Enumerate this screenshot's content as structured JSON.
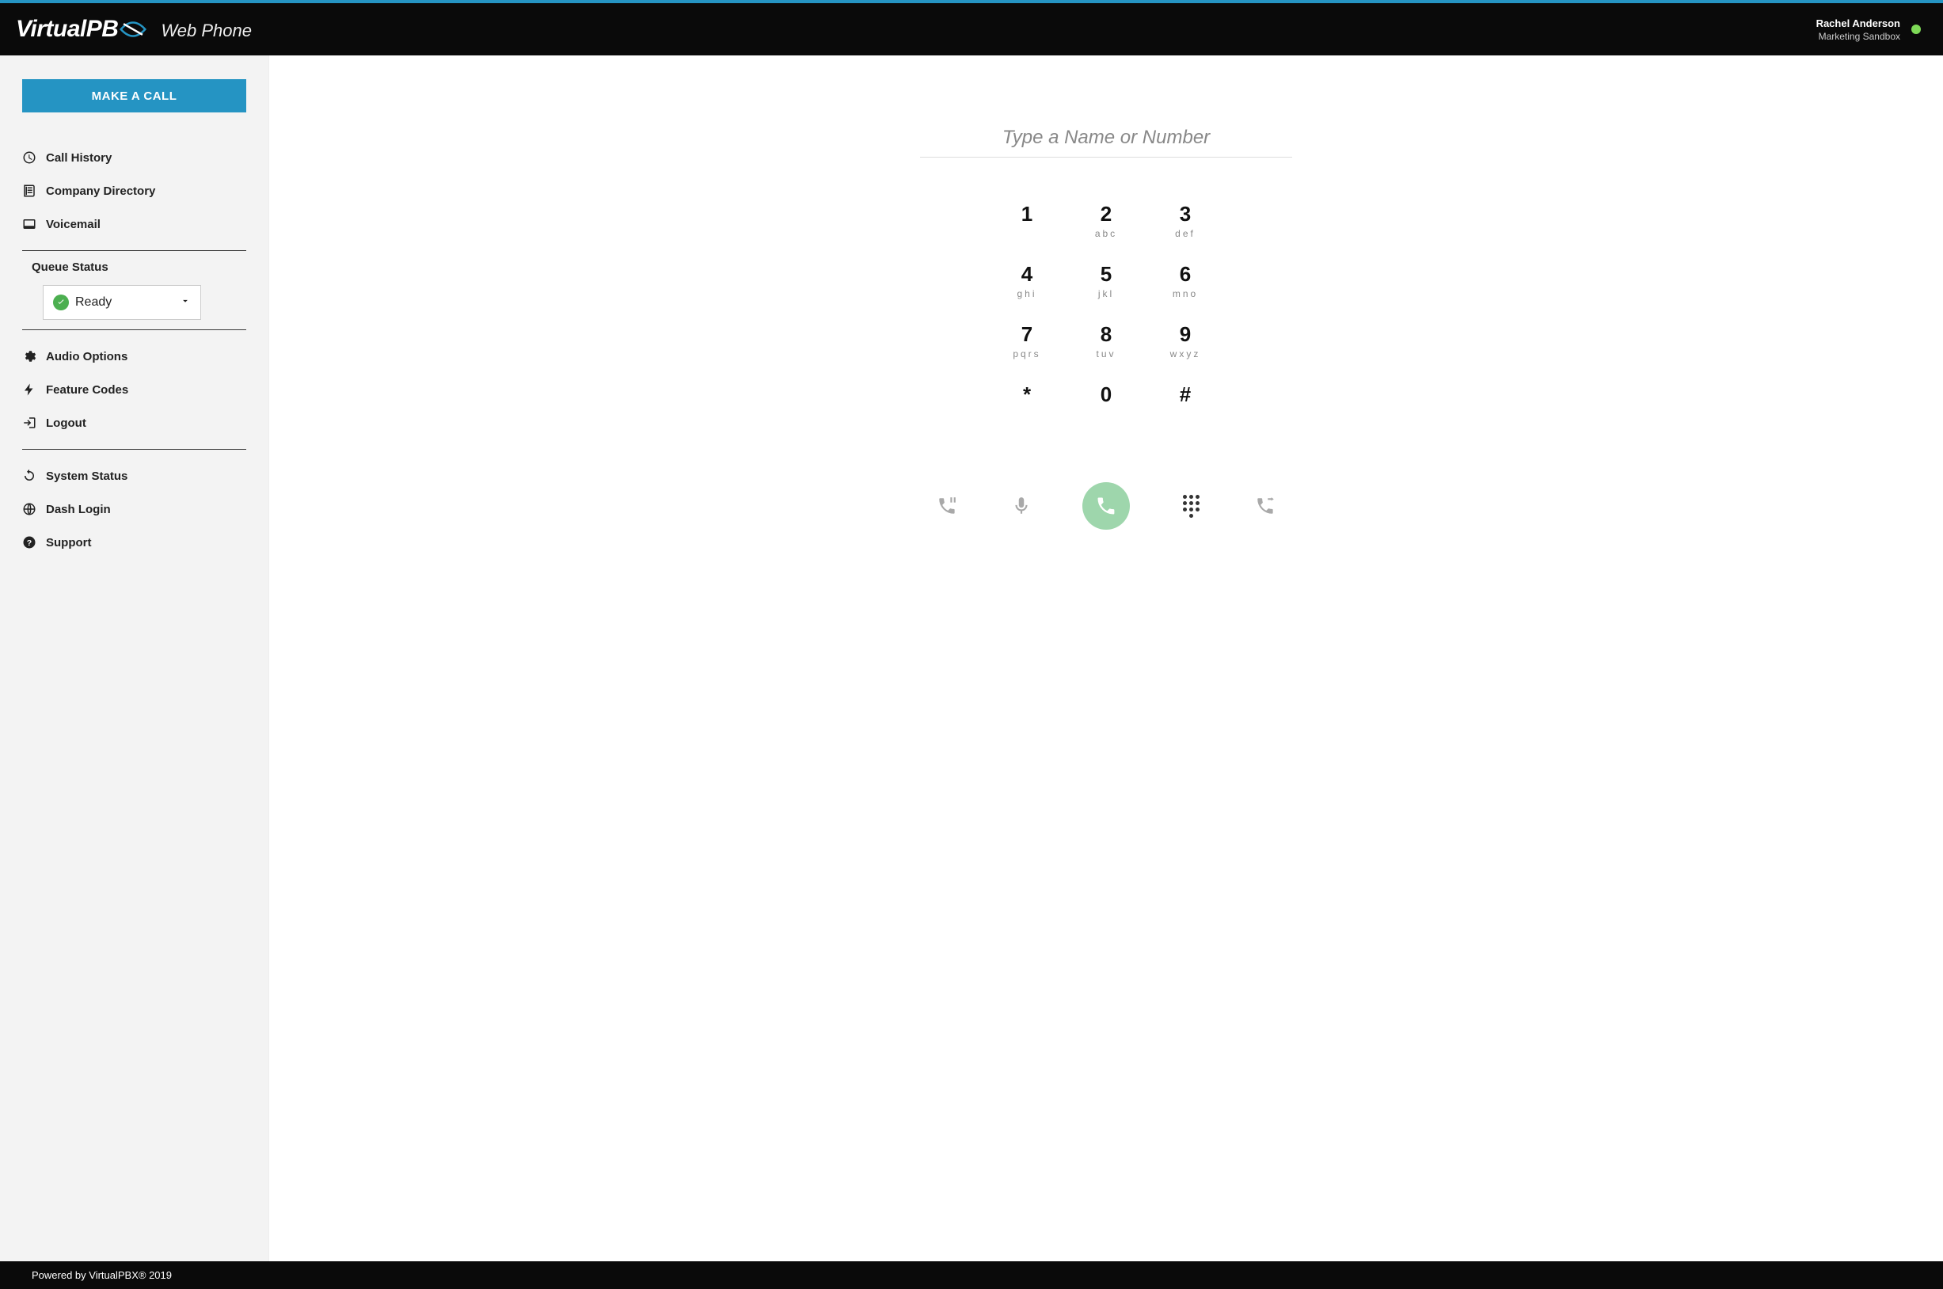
{
  "header": {
    "logo_prefix": "Virtual",
    "logo_suffix": "PB",
    "product_name": "Web Phone",
    "user_name": "Rachel Anderson",
    "user_subtitle": "Marketing Sandbox",
    "status_color": "#7ed957"
  },
  "sidebar": {
    "make_call_label": "MAKE A CALL",
    "nav1": [
      {
        "label": "Call History",
        "icon": "clock-icon"
      },
      {
        "label": "Company Directory",
        "icon": "directory-icon"
      },
      {
        "label": "Voicemail",
        "icon": "voicemail-icon"
      }
    ],
    "queue_status_label": "Queue Status",
    "queue_selected": "Ready",
    "nav2": [
      {
        "label": "Audio Options",
        "icon": "gear-icon"
      },
      {
        "label": "Feature Codes",
        "icon": "bolt-icon"
      },
      {
        "label": "Logout",
        "icon": "logout-icon"
      }
    ],
    "nav3": [
      {
        "label": "System Status",
        "icon": "refresh-icon"
      },
      {
        "label": "Dash Login",
        "icon": "globe-icon"
      },
      {
        "label": "Support",
        "icon": "help-icon"
      }
    ]
  },
  "dialer": {
    "input_placeholder": "Type a Name or Number",
    "keys": [
      {
        "digit": "1",
        "letters": ""
      },
      {
        "digit": "2",
        "letters": "abc"
      },
      {
        "digit": "3",
        "letters": "def"
      },
      {
        "digit": "4",
        "letters": "ghi"
      },
      {
        "digit": "5",
        "letters": "jkl"
      },
      {
        "digit": "6",
        "letters": "mno"
      },
      {
        "digit": "7",
        "letters": "pqrs"
      },
      {
        "digit": "8",
        "letters": "tuv"
      },
      {
        "digit": "9",
        "letters": "wxyz"
      },
      {
        "digit": "*",
        "letters": ""
      },
      {
        "digit": "0",
        "letters": ""
      },
      {
        "digit": "#",
        "letters": ""
      }
    ],
    "actions": {
      "hold": "hold",
      "mute": "mute",
      "call": "call",
      "keypad": "keypad",
      "transfer": "transfer"
    }
  },
  "footer": {
    "text": "Powered by VirtualPBX® 2019"
  }
}
